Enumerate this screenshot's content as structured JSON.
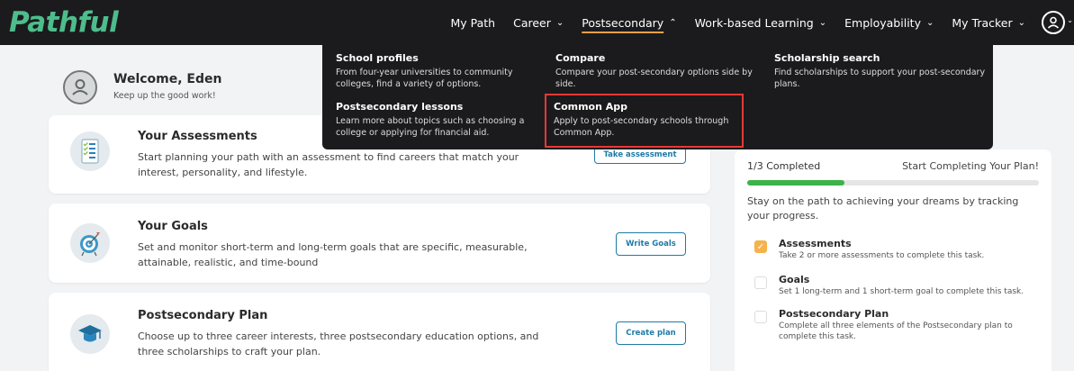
{
  "brand": {
    "name": "Pathful"
  },
  "nav": {
    "items": [
      {
        "label": "My Path",
        "chevron": ""
      },
      {
        "label": "Career",
        "chevron": "⌄"
      },
      {
        "label": "Postsecondary",
        "chevron": "⌃"
      },
      {
        "label": "Work-based Learning",
        "chevron": "⌄"
      },
      {
        "label": "Employability",
        "chevron": "⌄"
      },
      {
        "label": "My Tracker",
        "chevron": "⌄"
      }
    ],
    "active_color": "#f0a04b"
  },
  "dropdown": {
    "items": [
      {
        "title": "School profiles",
        "desc": "From four-year universities to community colleges, find a variety of options."
      },
      {
        "title": "Compare",
        "desc": "Compare your post-secondary options side by side."
      },
      {
        "title": "Scholarship search",
        "desc": "Find scholarships to support your post-secondary plans."
      },
      {
        "title": "Postsecondary lessons",
        "desc": "Learn more about topics such as choosing a college or applying for financial aid."
      },
      {
        "title": "Common App",
        "desc": "Apply to post-secondary schools through Common App."
      }
    ],
    "highlight_color": "#e53935"
  },
  "welcome": {
    "title": "Welcome, Eden",
    "subtitle": "Keep up the good work!"
  },
  "cards": [
    {
      "title": "Your Assessments",
      "desc": "Start planning your path with an assessment to find careers that match your interest, personality, and lifestyle.",
      "button": "Take assessment",
      "icon": "checklist-icon"
    },
    {
      "title": "Your Goals",
      "desc": "Set and monitor short-term and long-term goals that are specific, measurable, attainable, realistic, and time-bound",
      "button": "Write Goals",
      "icon": "target-icon"
    },
    {
      "title": "Postsecondary Plan",
      "desc": "Choose up to three career interests, three postsecondary education options, and three scholarships to craft your plan.",
      "button": "Create plan",
      "icon": "graduation-cap-icon"
    }
  ],
  "plan_panel": {
    "progress_label": "1/3 Completed",
    "progress_link": "Start Completing Your Plan!",
    "progress_fraction": 0.333,
    "progress_color": "#3bb34a",
    "intro": "Stay on the path to achieving your dreams by tracking your progress.",
    "tasks": [
      {
        "title": "Assessments",
        "desc": "Take 2 or more assessments to complete this task.",
        "done": true,
        "check": "✓"
      },
      {
        "title": "Goals",
        "desc": "Set 1 long-term and 1 short-term goal to complete this task.",
        "done": false,
        "check": ""
      },
      {
        "title": "Postsecondary Plan",
        "desc": "Complete all three elements of the Postsecondary plan to complete this task.",
        "done": false,
        "check": ""
      }
    ]
  }
}
